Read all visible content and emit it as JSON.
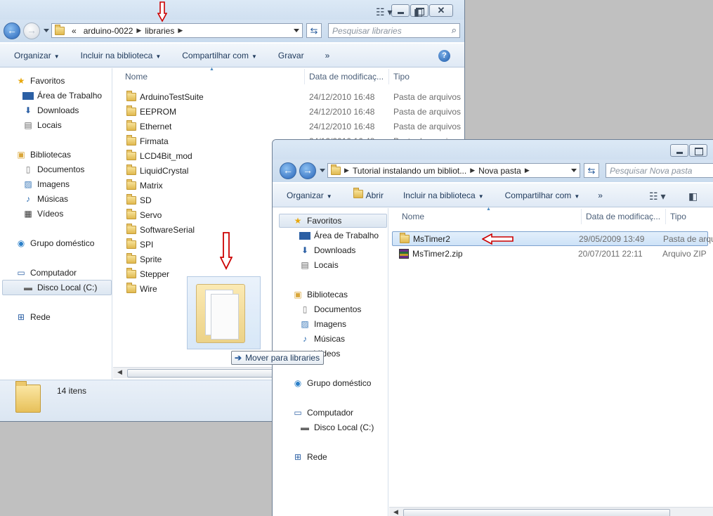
{
  "window1": {
    "address": [
      "arduino-0022",
      "libraries"
    ],
    "address_prefix": "«",
    "search_placeholder": "Pesquisar libraries",
    "toolbar": [
      "Organizar",
      "Incluir na biblioteca",
      "Compartilhar com",
      "Gravar",
      "»"
    ],
    "columns": [
      "Nome",
      "Data de modificaç...",
      "Tipo"
    ],
    "nav": {
      "favorites": "Favoritos",
      "favorites_items": [
        "Área de Trabalho",
        "Downloads",
        "Locais"
      ],
      "libraries": "Bibliotecas",
      "libraries_items": [
        "Documentos",
        "Imagens",
        "Músicas",
        "Vídeos"
      ],
      "homegroup": "Grupo doméstico",
      "computer": "Computador",
      "computer_items": [
        "Disco Local (C:)"
      ],
      "network": "Rede"
    },
    "files": [
      {
        "name": "ArduinoTestSuite",
        "date": "24/12/2010 16:48",
        "type": "Pasta de arquivos"
      },
      {
        "name": "EEPROM",
        "date": "24/12/2010 16:48",
        "type": "Pasta de arquivos"
      },
      {
        "name": "Ethernet",
        "date": "24/12/2010 16:48",
        "type": "Pasta de arquivos"
      },
      {
        "name": "Firmata",
        "date": "24/12/2010 16:48",
        "type": "Pasta de arquivos"
      },
      {
        "name": "LCD4Bit_mod",
        "date": "",
        "type": ""
      },
      {
        "name": "LiquidCrystal",
        "date": "",
        "type": ""
      },
      {
        "name": "Matrix",
        "date": "",
        "type": ""
      },
      {
        "name": "SD",
        "date": "",
        "type": ""
      },
      {
        "name": "Servo",
        "date": "",
        "type": ""
      },
      {
        "name": "SoftwareSerial",
        "date": "",
        "type": ""
      },
      {
        "name": "SPI",
        "date": "",
        "type": ""
      },
      {
        "name": "Sprite",
        "date": "",
        "type": ""
      },
      {
        "name": "Stepper",
        "date": "",
        "type": ""
      },
      {
        "name": "Wire",
        "date": "",
        "type": ""
      }
    ],
    "status_count": "14 itens"
  },
  "drag_tooltip": "Mover para libraries",
  "window2": {
    "address": [
      "Tutorial instalando um bibliot...",
      "Nova pasta"
    ],
    "search_placeholder": "Pesquisar Nova pasta",
    "toolbar": [
      "Organizar",
      "Abrir",
      "Incluir na biblioteca",
      "Compartilhar com",
      "»"
    ],
    "columns": [
      "Nome",
      "Data de modificaç...",
      "Tipo"
    ],
    "nav": {
      "favorites": "Favoritos",
      "favorites_items": [
        "Área de Trabalho",
        "Downloads",
        "Locais"
      ],
      "libraries": "Bibliotecas",
      "libraries_items": [
        "Documentos",
        "Imagens",
        "Músicas",
        "Vídeos"
      ],
      "homegroup": "Grupo doméstico",
      "computer": "Computador",
      "computer_items": [
        "Disco Local (C:)"
      ],
      "network": "Rede"
    },
    "files": [
      {
        "name": "MsTimer2",
        "date": "29/05/2009 13:49",
        "type": "Pasta de arquivos",
        "icon": "folder-icon"
      },
      {
        "name": "MsTimer2.zip",
        "date": "20/07/2011 22:11",
        "type": "Arquivo ZIP",
        "icon": "zip-archive-icon"
      }
    ]
  },
  "colors": {
    "annotation_arrow": "#cc0000",
    "selection": "#cde2f7"
  }
}
